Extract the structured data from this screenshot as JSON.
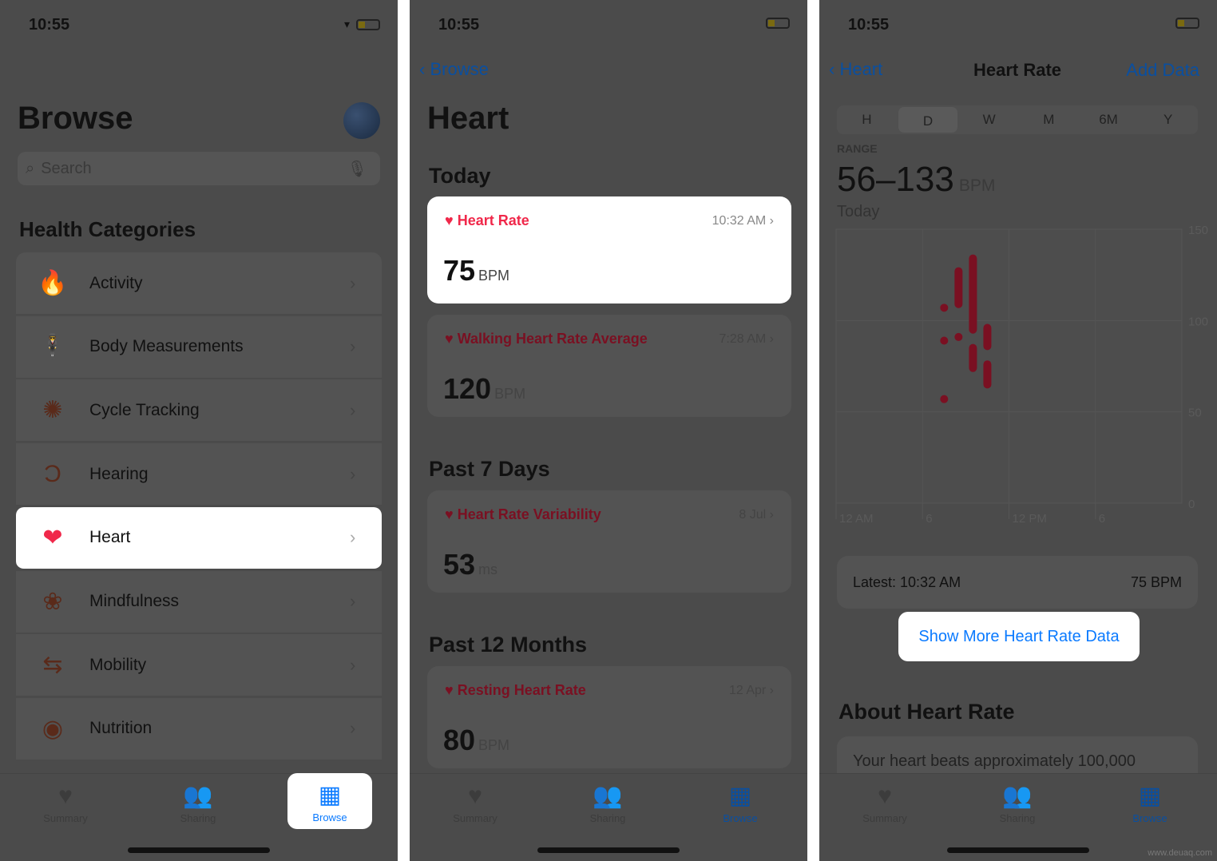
{
  "status": {
    "time": "10:55"
  },
  "panel1": {
    "title": "Browse",
    "search_placeholder": "Search",
    "section": "Health Categories",
    "categories": [
      {
        "label": "Activity",
        "icon": "flame-icon"
      },
      {
        "label": "Body Measurements",
        "icon": "figure-icon"
      },
      {
        "label": "Cycle Tracking",
        "icon": "cycle-icon"
      },
      {
        "label": "Hearing",
        "icon": "ear-icon"
      },
      {
        "label": "Heart",
        "icon": "heart-icon",
        "highlighted": true
      },
      {
        "label": "Mindfulness",
        "icon": "flower-icon"
      },
      {
        "label": "Mobility",
        "icon": "arrows-icon"
      },
      {
        "label": "Nutrition",
        "icon": "apple-icon"
      }
    ]
  },
  "tabs": [
    {
      "label": "Summary"
    },
    {
      "label": "Sharing"
    },
    {
      "label": "Browse",
      "active": true
    }
  ],
  "panel2": {
    "back": "Browse",
    "title": "Heart",
    "sections": [
      {
        "title": "Today",
        "cards": [
          {
            "title": "Heart Rate",
            "time": "10:32 AM",
            "value": "75",
            "unit": "BPM",
            "highlighted": true
          },
          {
            "title": "Walking Heart Rate Average",
            "time": "7:28 AM",
            "value": "120",
            "unit": "BPM"
          }
        ]
      },
      {
        "title": "Past 7 Days",
        "cards": [
          {
            "title": "Heart Rate Variability",
            "time": "8 Jul",
            "value": "53",
            "unit": "ms"
          }
        ]
      },
      {
        "title": "Past 12 Months",
        "cards": [
          {
            "title": "Resting Heart Rate",
            "time": "12 Apr",
            "value": "80",
            "unit": "BPM"
          }
        ]
      }
    ]
  },
  "panel3": {
    "back": "Heart",
    "title": "Heart Rate",
    "add": "Add Data",
    "segments": [
      "H",
      "D",
      "W",
      "M",
      "6M",
      "Y"
    ],
    "selected_segment": "D",
    "range_label": "RANGE",
    "range_value": "56–133",
    "range_unit": "BPM",
    "period": "Today",
    "latest_label": "Latest: 10:32 AM",
    "latest_value": "75 BPM",
    "show_more": "Show More Heart Rate Data",
    "about_title": "About Heart Rate",
    "about_text": "Your heart beats approximately 100,000"
  },
  "chart_data": {
    "type": "range-bar",
    "x_ticks": [
      "12 AM",
      "6",
      "12 PM",
      "6"
    ],
    "y_ticks": [
      "150",
      "100",
      "50",
      "0"
    ],
    "ylim": [
      0,
      150
    ],
    "xlim_hours": [
      0,
      24
    ],
    "points": [
      {
        "hour": 7.5,
        "min": 107,
        "max": 107
      },
      {
        "hour": 7.5,
        "min": 89,
        "max": 89
      },
      {
        "hour": 7.5,
        "min": 57,
        "max": 57
      },
      {
        "hour": 8.5,
        "min": 109,
        "max": 127
      },
      {
        "hour": 8.5,
        "min": 91,
        "max": 91
      },
      {
        "hour": 9.5,
        "min": 95,
        "max": 134
      },
      {
        "hour": 9.5,
        "min": 74,
        "max": 85
      },
      {
        "hour": 10.5,
        "min": 86,
        "max": 96
      },
      {
        "hour": 10.5,
        "min": 65,
        "max": 76
      }
    ],
    "color": "#7a1022"
  },
  "watermark": "www.deuaq.com"
}
